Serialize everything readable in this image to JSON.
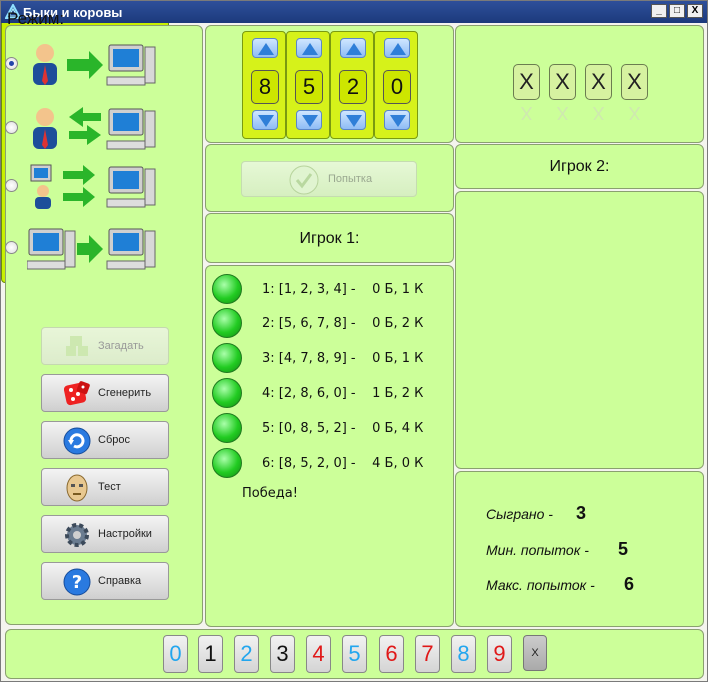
{
  "window": {
    "title": "Быки и коровы",
    "minimize": "_",
    "maximize": "□",
    "close": "X"
  },
  "mode": {
    "title": "Режим:",
    "options": [
      {
        "icon": "user-to-computer-icon",
        "selected": true
      },
      {
        "icon": "user-computer-exchange-icon",
        "selected": false
      },
      {
        "icon": "computer-user-to-computer-icon",
        "selected": false
      },
      {
        "icon": "computer-to-computer-icon",
        "selected": false
      }
    ]
  },
  "sidebar": {
    "guess_label": "Загадать",
    "generate_label": "Сгенерить",
    "reset_label": "Сброс",
    "test_label": "Тест",
    "settings_label": "Настройки",
    "help_label": "Справка"
  },
  "input_digits": [
    "8",
    "5",
    "2",
    "0"
  ],
  "try_button": "Попытка",
  "hidden_digits": [
    "X",
    "X",
    "X",
    "X"
  ],
  "player1": {
    "title": "Игрок 1:",
    "attempts": [
      "1: [1, 2, 3, 4] -    0 Б, 1 К",
      "2: [5, 6, 7, 8] -    0 Б, 2 К",
      "3: [4, 7, 8, 9] -    0 Б, 1 К",
      "4: [2, 8, 6, 0] -    1 Б, 2 К",
      "5: [0, 8, 5, 2] -    0 Б, 4 К",
      "6: [8, 5, 2, 0] -    4 Б, 0 К"
    ],
    "result": "Победа!"
  },
  "player2": {
    "title": "Игрок 2:"
  },
  "stats": {
    "played_label": "Сыграно -",
    "played_value": "3",
    "min_label": "Мин. попыток -",
    "min_value": "5",
    "max_label": "Макс. попыток -",
    "max_value": "6"
  },
  "keypad": {
    "keys": [
      {
        "digit": "0",
        "color": "#22a6ee"
      },
      {
        "digit": "1",
        "color": "#111111"
      },
      {
        "digit": "2",
        "color": "#22a6ee"
      },
      {
        "digit": "3",
        "color": "#111111"
      },
      {
        "digit": "4",
        "color": "#e01818"
      },
      {
        "digit": "5",
        "color": "#22a6ee"
      },
      {
        "digit": "6",
        "color": "#e01818"
      },
      {
        "digit": "7",
        "color": "#e01818"
      },
      {
        "digit": "8",
        "color": "#22a6ee"
      },
      {
        "digit": "9",
        "color": "#e01818"
      }
    ],
    "clear_label": "X"
  }
}
